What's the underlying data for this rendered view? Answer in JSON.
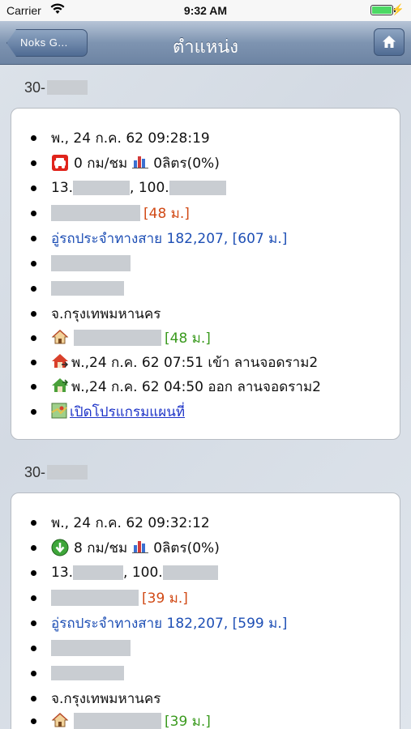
{
  "status_bar": {
    "carrier": "Carrier",
    "time": "9:32 AM"
  },
  "nav": {
    "back_label": "Noks G...",
    "title": "ตำแหน่ง"
  },
  "entries": [
    {
      "header": "30-",
      "datetime": "พ., 24 ก.ค. 62 09:28:19",
      "speed_icon": "parked-car-icon",
      "speed": "0 กม/ชม",
      "fuel": "0ลิตร(0%)",
      "coord_lat_prefix": "13.",
      "coord_sep": ", 100.",
      "place_distance": "[48 ม.]",
      "route": "อู่รถประจำทางสาย 182,207, [607 ม.]",
      "province": "จ.กรุงเทพมหานคร",
      "home_distance": "[48 ม.]",
      "enter_event": "พ.,24 ก.ค. 62 07:51 เข้า ลานจอดราม2",
      "exit_event": "พ.,24 ก.ค. 62 04:50 ออก ลานจอดราม2",
      "map_link": "เปิดโปรแกรมแผนที่"
    },
    {
      "header": "30-",
      "datetime": "พ., 24 ก.ค. 62 09:32:12",
      "speed_icon": "moving-arrow-icon",
      "speed": "8 กม/ชม",
      "fuel": "0ลิตร(0%)",
      "coord_lat_prefix": "13.",
      "coord_sep": ", 100.",
      "place_distance": "[39 ม.]",
      "route": "อู่รถประจำทางสาย 182,207, [599 ม.]",
      "province": "จ.กรุงเทพมหานคร",
      "home_distance": "[39 ม.]"
    }
  ]
}
